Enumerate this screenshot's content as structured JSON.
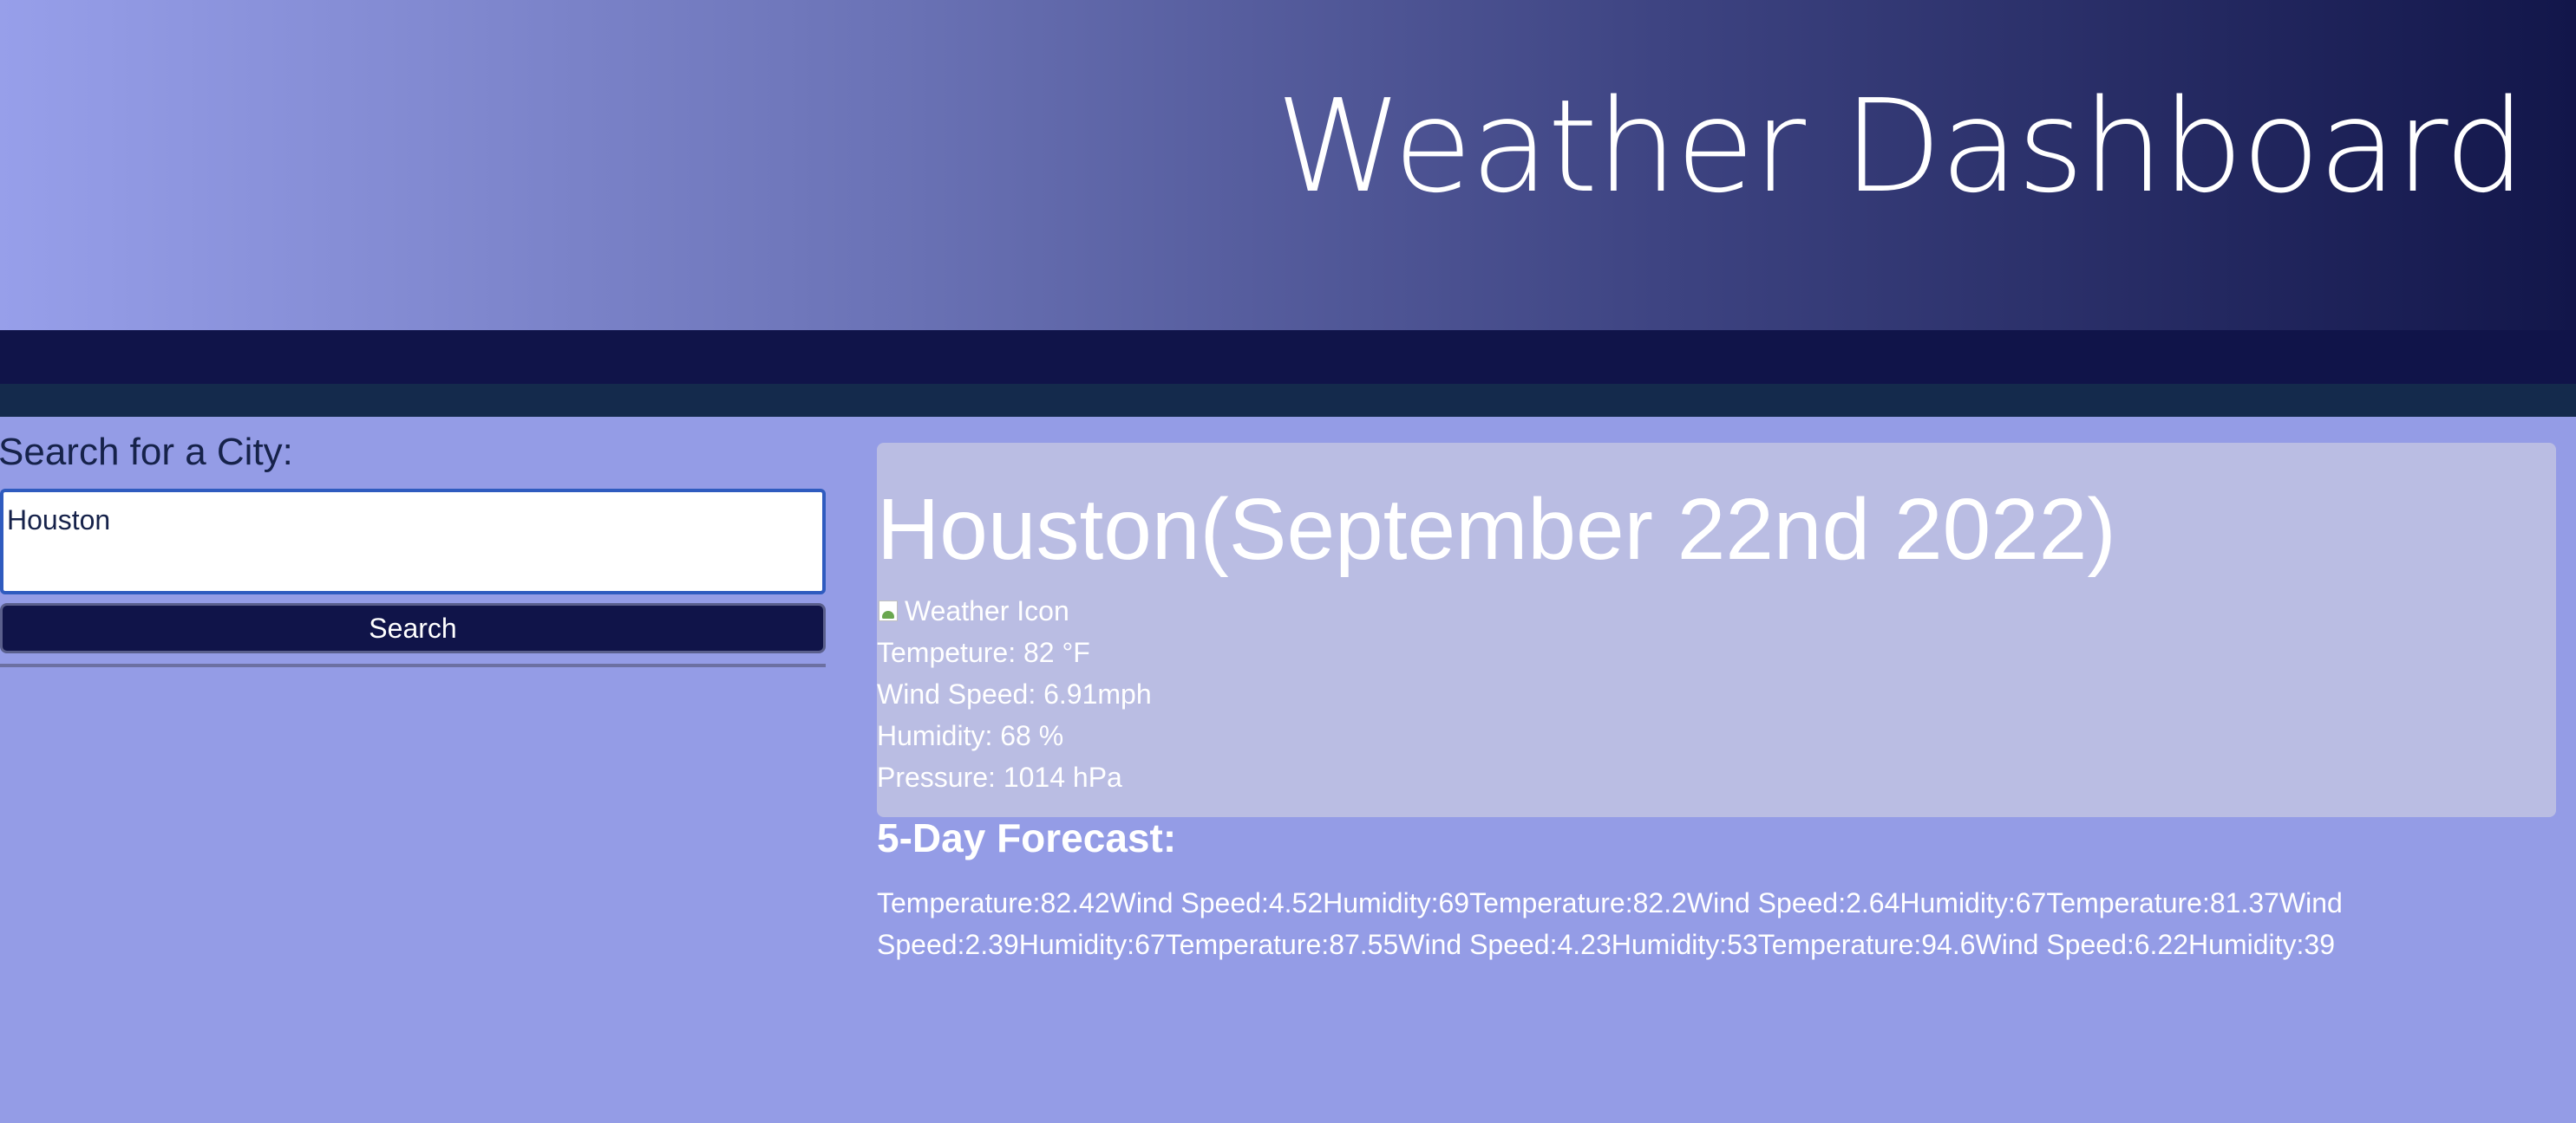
{
  "header": {
    "title": "Weather Dashboard"
  },
  "search": {
    "label": "Search for a City:",
    "input_value": "Houston",
    "button_label": "Search"
  },
  "current": {
    "heading": "Houston(September 22nd 2022)",
    "icon_alt": "Weather Icon",
    "temperature": "Tempeture: 82 °F",
    "wind": "Wind Speed: 6.91mph",
    "humidity": "Humidity: 68 %",
    "pressure": "Pressure: 1014 hPa"
  },
  "forecast": {
    "title": "5-Day Forecast:",
    "line1": "Temperature:82.42Wind Speed:4.52Humidity:69Temperature:82.2Wind Speed:2.64Humidity:67Temperature:81.37Wind",
    "line2": "Speed:2.39Humidity:67Temperature:87.55Wind Speed:4.23Humidity:53Temperature:94.6Wind Speed:6.22Humidity:39"
  },
  "colors": {
    "page_background": "#949ce6",
    "header_gradient_start": "#979fea",
    "header_gradient_end": "#12164a",
    "nav_bar": "#101449",
    "accent_bar": "#142a4c",
    "card_background": "#babde3",
    "button_background": "#101449"
  }
}
